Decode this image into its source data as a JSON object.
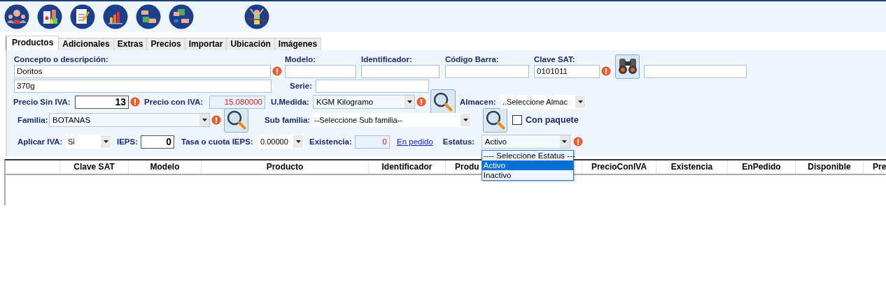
{
  "tabs": [
    {
      "label": "Productos",
      "selected": true
    },
    {
      "label": "Adicionales",
      "selected": false
    },
    {
      "label": "Extras",
      "selected": false
    },
    {
      "label": "Precios",
      "selected": false
    },
    {
      "label": "Importar",
      "selected": false
    },
    {
      "label": "Ubicación",
      "selected": false
    },
    {
      "label": "Imágenes",
      "selected": false
    }
  ],
  "form": {
    "concepto": {
      "label": "Concepto o descripción:",
      "value": "Doritos",
      "warning": true
    },
    "modelo": {
      "label": "Modelo:"
    },
    "identificador": {
      "label": "Identificador:"
    },
    "codigo_barra": {
      "label": "Código Barra:"
    },
    "clave_sat": {
      "label": "Clave SAT:",
      "value": "0101011",
      "warning": true
    },
    "descripcion_2": {
      "value": "370g"
    },
    "serie": {
      "label": "Serie:"
    },
    "precio_sin_iva": {
      "label": "Precio Sin IVA:",
      "value": "13",
      "warning": true
    },
    "precio_con_iva": {
      "label": "Precio con IVA:",
      "value": "15.080000"
    },
    "unidad_medida": {
      "label": "U.Medida:",
      "value": "KGM Kilogramo",
      "warning": true
    },
    "almacen": {
      "label": "Almacen:",
      "value": "..Seleccione Almac"
    },
    "familia": {
      "label": "Familia:",
      "value": "BOTANAS",
      "warning": true
    },
    "sub_familia": {
      "label": "Sub familia:",
      "value": "--Seleccione Sub familia--"
    },
    "con_paquete": {
      "label": "Con paquete",
      "checked": false
    },
    "aplicar_iva": {
      "label": "Aplicar IVA:",
      "value": "Si"
    },
    "ieps": {
      "label": "IEPS:",
      "value": "0"
    },
    "tasa_ieps": {
      "label": "Tasa o cuota IEPS:",
      "value": "0.00000"
    },
    "existencia": {
      "label": "Existencia:",
      "value": "0"
    },
    "en_pedido_link": "En pedido",
    "estatus": {
      "label": "Estatus:",
      "value": "Activo",
      "warning": true,
      "options": [
        {
          "label": "---- Seleccione Estatus ---",
          "selected": false
        },
        {
          "label": "Activo",
          "selected": true
        },
        {
          "label": "Inactivo",
          "selected": false
        }
      ]
    }
  },
  "table": {
    "columns": [
      {
        "label": "Clave SAT",
        "truncated": false
      },
      {
        "label": "Modelo",
        "truncated": false
      },
      {
        "label": "Producto",
        "truncated": false
      },
      {
        "label": "Identificador",
        "truncated": false
      },
      {
        "label": "Produ",
        "truncated": true
      },
      {
        "label": "PrecioConIVA",
        "truncated": false
      },
      {
        "label": "Existencia",
        "truncated": false
      },
      {
        "label": "EnPedido",
        "truncated": false
      },
      {
        "label": "Disponible",
        "truncated": false
      },
      {
        "label": "Pre",
        "truncated": true
      }
    ]
  }
}
